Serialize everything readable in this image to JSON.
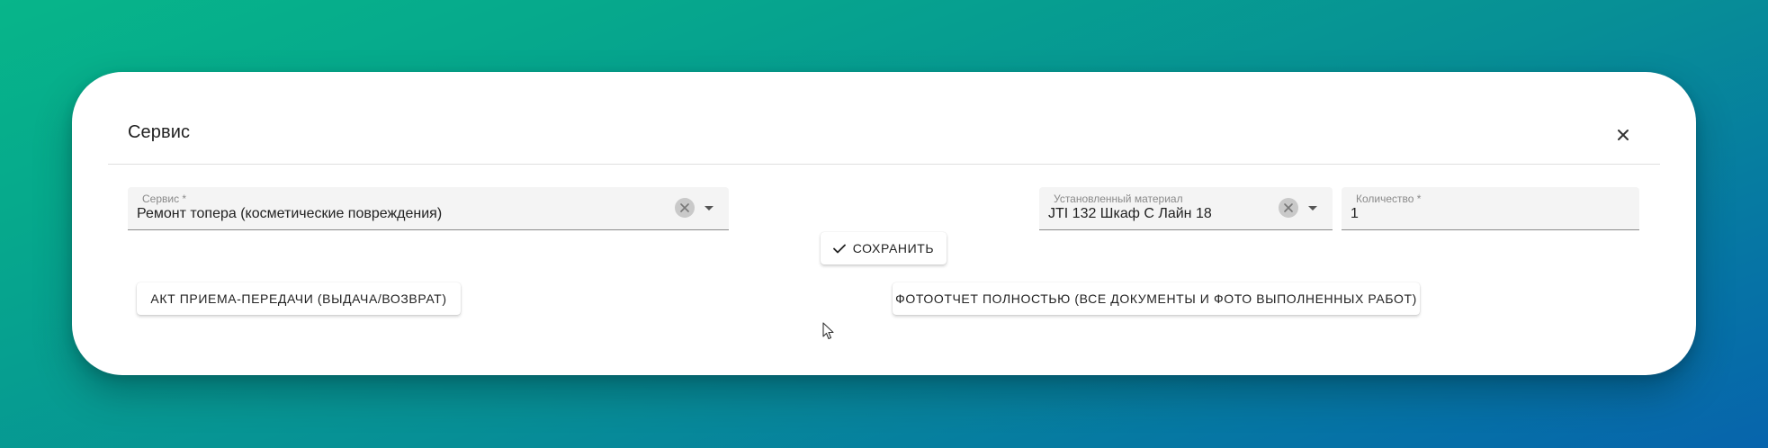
{
  "dialog": {
    "title": "Сервис",
    "close_icon": "close-icon"
  },
  "service_field": {
    "label": "Сервис *",
    "value": "Ремонт топера (косметические повреждения)"
  },
  "material_field": {
    "label": "Установленный материал",
    "value": "JTI 132 Шкаф С Лайн 18"
  },
  "quantity_field": {
    "label": "Количество *",
    "value": "1"
  },
  "buttons": {
    "save": "СОХРАНИТЬ",
    "act": "АКТ ПРИЕМА-ПЕРЕДАЧИ (ВЫДАЧА/ВОЗВРАТ)",
    "photo_report": "ФОТООТЧЕТ ПОЛНОСТЬЮ (ВСЕ ДОКУМЕНТЫ И ФОТО ВЫПОЛНЕННЫХ РАБОТ)"
  },
  "icons": {
    "clear": "clear-circle-icon",
    "dropdown": "arrow-drop-down-icon",
    "check": "check-icon",
    "cursor": "mouse-pointer-icon"
  },
  "colors": {
    "background_start": "#07b58a",
    "background_end": "#0764ac",
    "dialog": "#ffffff",
    "field_background": "#f4f4f4"
  }
}
